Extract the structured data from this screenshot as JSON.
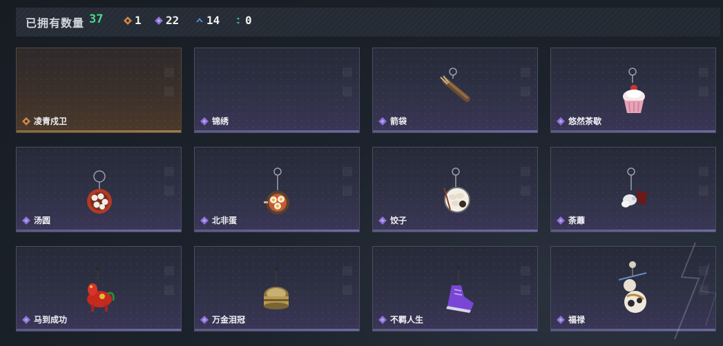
{
  "header": {
    "owned_label": "已拥有数量",
    "owned_count": "37",
    "rarities": [
      {
        "icon": "orange-diamond-icon",
        "color": "#d28a4a",
        "count": "1"
      },
      {
        "icon": "purple-diamond-icon",
        "color": "#8c72d6",
        "count": "22"
      },
      {
        "icon": "blue-chevron-icon",
        "color": "#4f8fd8",
        "count": "14"
      },
      {
        "icon": "green-dot-icon",
        "color": "#3fc2a6",
        "count": "0"
      }
    ]
  },
  "cards": [
    {
      "name": "凌青戍卫",
      "rarity": "orange",
      "charm": "none"
    },
    {
      "name": "锦绣",
      "rarity": "purple",
      "charm": "none"
    },
    {
      "name": "箭袋",
      "rarity": "purple",
      "charm": "quiver-charm-icon"
    },
    {
      "name": "悠然茶歇",
      "rarity": "purple",
      "charm": "cupcake-charm-icon"
    },
    {
      "name": "汤圆",
      "rarity": "purple",
      "charm": "tangyuan-bowl-charm-icon"
    },
    {
      "name": "北非蛋",
      "rarity": "purple",
      "charm": "egg-pan-charm-icon"
    },
    {
      "name": "饺子",
      "rarity": "purple",
      "charm": "dumpling-plate-charm-icon"
    },
    {
      "name": "荼蘼",
      "rarity": "purple",
      "charm": "flower-charm-icon"
    },
    {
      "name": "马到成功",
      "rarity": "purple",
      "charm": "red-horse-charm-icon"
    },
    {
      "name": "万金泪冠",
      "rarity": "purple",
      "charm": "golden-crown-charm-icon"
    },
    {
      "name": "不羁人生",
      "rarity": "purple",
      "charm": "purple-sneaker-charm-icon"
    },
    {
      "name": "福禄",
      "rarity": "purple",
      "charm": "gourd-charm-icon"
    }
  ]
}
